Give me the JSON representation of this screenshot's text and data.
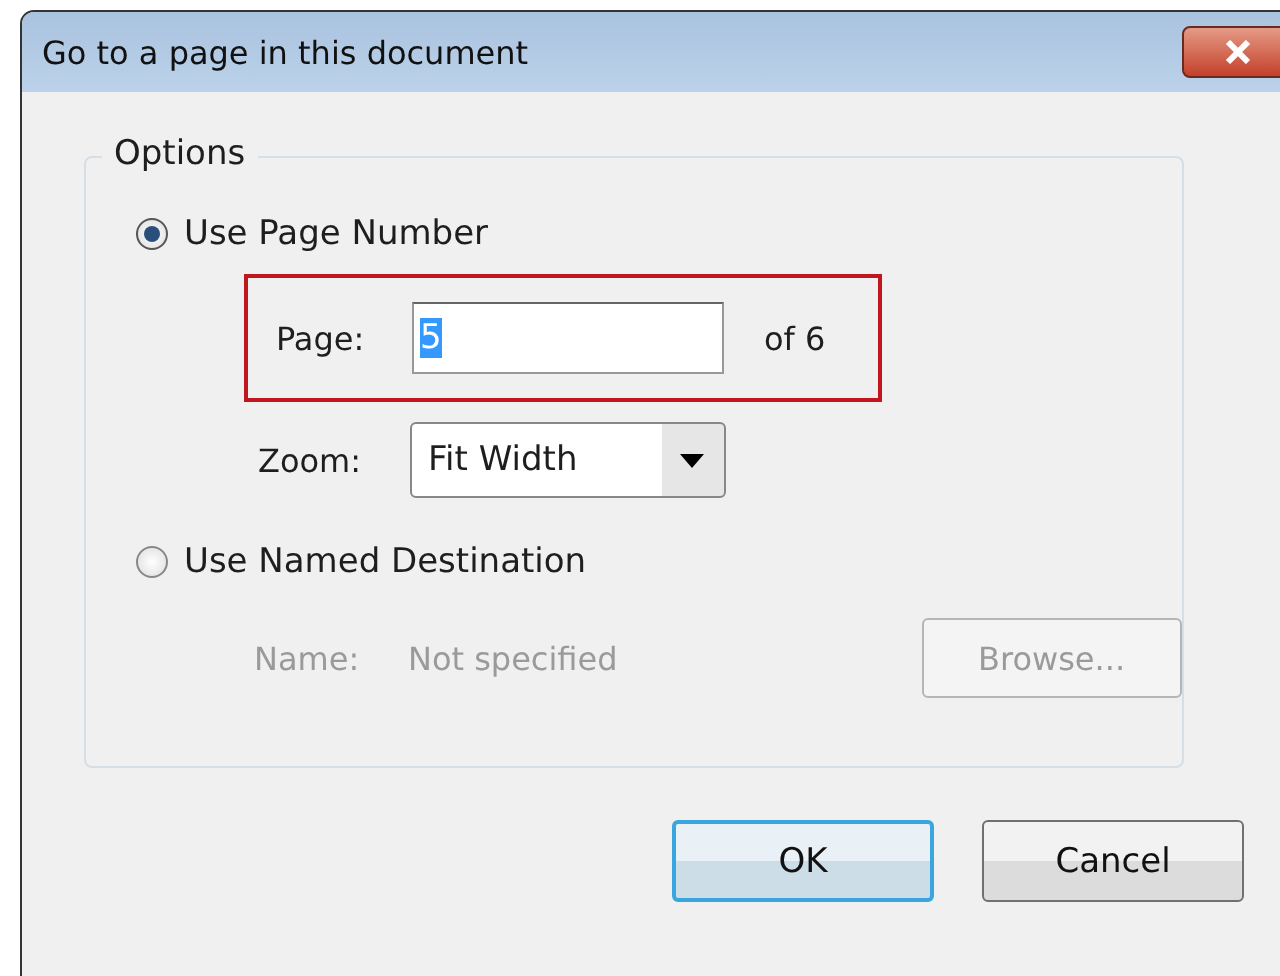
{
  "window": {
    "title": "Go to a page in this document"
  },
  "options": {
    "title": "Options",
    "modes": [
      {
        "label": "Use Page Number",
        "selected": true
      },
      {
        "label": "Use Named Destination",
        "selected": false
      }
    ],
    "page": {
      "label": "Page:",
      "value": "5",
      "value_selected": true,
      "total": "of 6",
      "highlighted": true
    },
    "zoom": {
      "label": "Zoom:",
      "value": "Fit Width"
    },
    "name": {
      "label": "Name:",
      "value": "Not specified",
      "disabled": true
    },
    "browse": {
      "label": "Browse...",
      "disabled": true
    }
  },
  "buttons": [
    {
      "label": "OK",
      "kind": "default"
    },
    {
      "label": "Cancel",
      "kind": "normal"
    }
  ]
}
